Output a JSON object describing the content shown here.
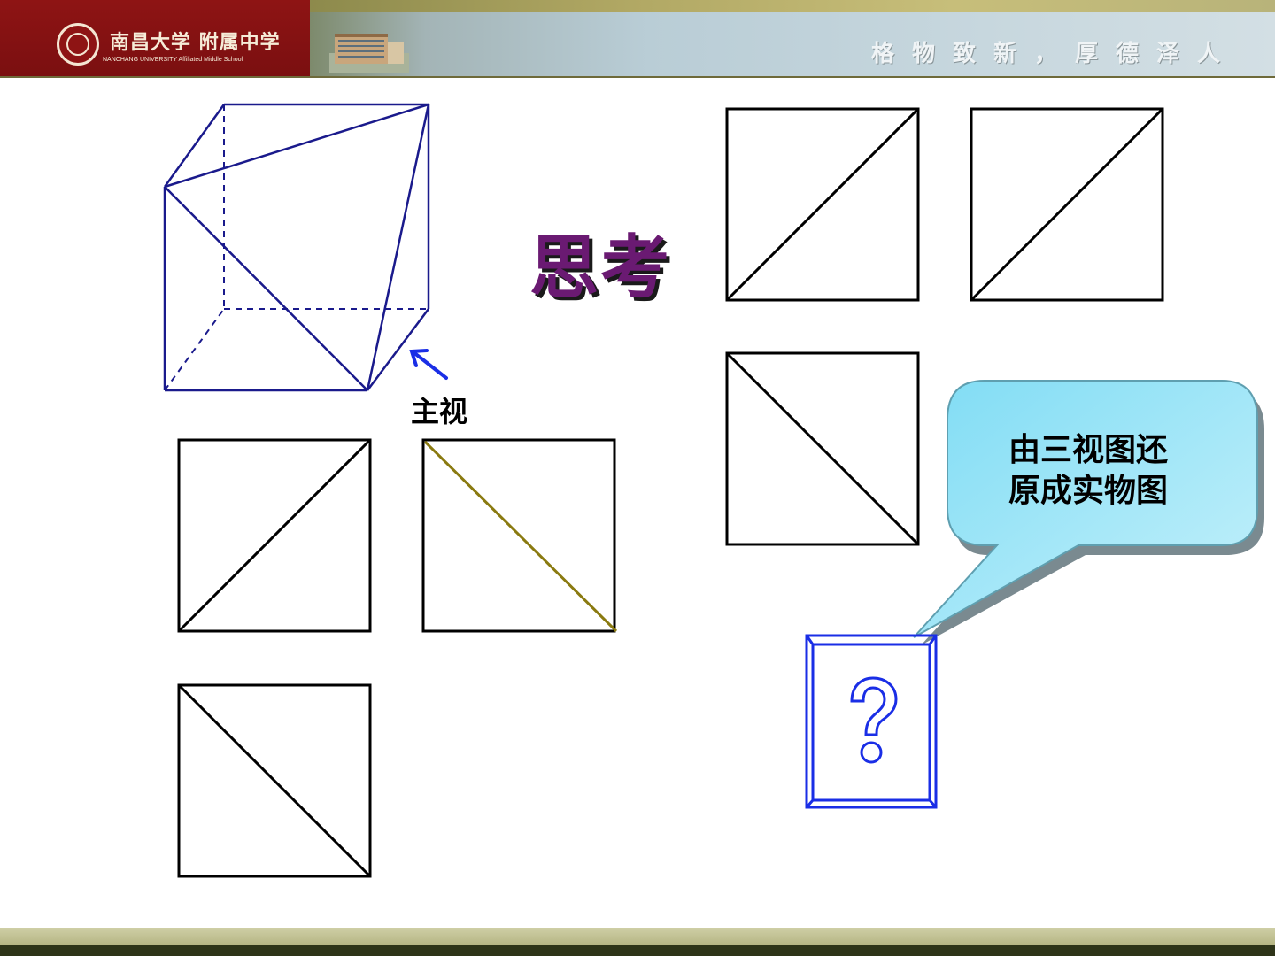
{
  "header": {
    "school_name_cn": "南昌大学 附属中学",
    "school_name_en": "NANCHANG UNIVERSITY Affiliated Middle School",
    "motto": "格物致新，厚德泽人"
  },
  "slide": {
    "title": "思考",
    "view_label": "主视",
    "callout_line1": "由三视图还",
    "callout_line2": "原成实物图",
    "question_mark": "?"
  },
  "colors": {
    "solid_edges": "#1a1a8c",
    "title": "#6a1a72",
    "callout_fill": "#8fe1f5",
    "question_frame": "#1a2ee6",
    "highlight_diagonal": "#8a7a10"
  }
}
